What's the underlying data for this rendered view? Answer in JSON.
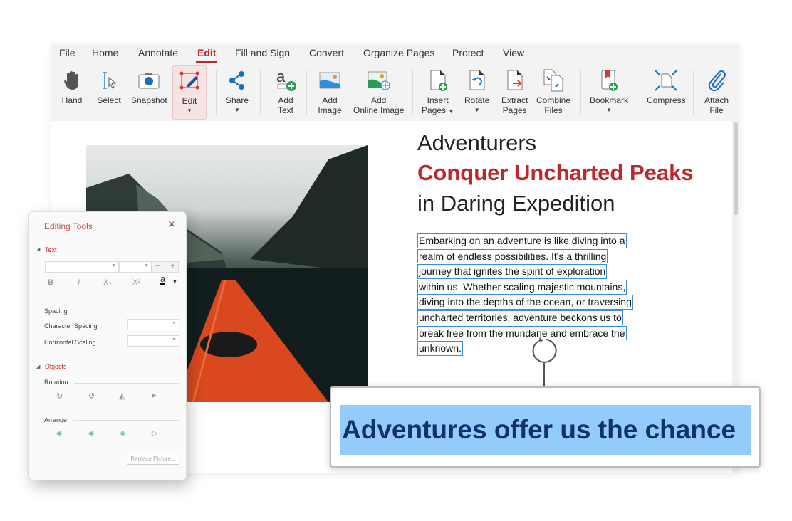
{
  "menu": [
    "File",
    "Home",
    "Annotate",
    "Edit",
    "Fill and Sign",
    "Convert",
    "Organize Pages",
    "Protect",
    "View"
  ],
  "active_menu": "Edit",
  "ribbon": {
    "hand": "Hand",
    "select": "Select",
    "snapshot": "Snapshot",
    "edit": "Edit",
    "share": "Share",
    "add_text": [
      "Add",
      "Text"
    ],
    "add_image": [
      "Add",
      "Image"
    ],
    "add_online_image": [
      "Add",
      "Online Image"
    ],
    "insert_pages": [
      "Insert",
      "Pages"
    ],
    "rotate": "Rotate",
    "extract_pages": [
      "Extract",
      "Pages"
    ],
    "combine_files": [
      "Combine",
      "Files"
    ],
    "bookmark": "Bookmark",
    "compress": "Compress",
    "attach_file": [
      "Attach",
      "File"
    ]
  },
  "document": {
    "title_line1": "Adventurers",
    "title_line2": "Conquer Uncharted Peaks",
    "title_line3": "in Daring Expedition",
    "paragraph": [
      "Embarking on an adventure is like diving into a",
      "realm of endless possibilities. It's a thrilling",
      "journey that ignites the spirit of exploration",
      "within us. Whether scaling majestic mountains,",
      "diving into the depths of the ocean, or traversing",
      "uncharted territories, adventure beckons us to",
      "break free from the mundane and embrace the",
      "unknown."
    ]
  },
  "callout": {
    "text": "Adventures offer us the chance"
  },
  "panel": {
    "title": "Editing Tools",
    "text_section": "Text",
    "bold": "B",
    "italic": "I",
    "subscript": "X₂",
    "superscript": "X²",
    "font_color": "a",
    "spacing": "Spacing",
    "character_spacing": "Character Spacing",
    "horizontal_scaling": "Horizontal Scaling",
    "objects_section": "Objects",
    "rotation": "Rotation",
    "arrange": "Arrange",
    "replace_picture": "Replace Picture..."
  },
  "colors": {
    "accent": "#c0272d",
    "highlight": "#93cbf9",
    "selection_border": "#3b8de0"
  }
}
